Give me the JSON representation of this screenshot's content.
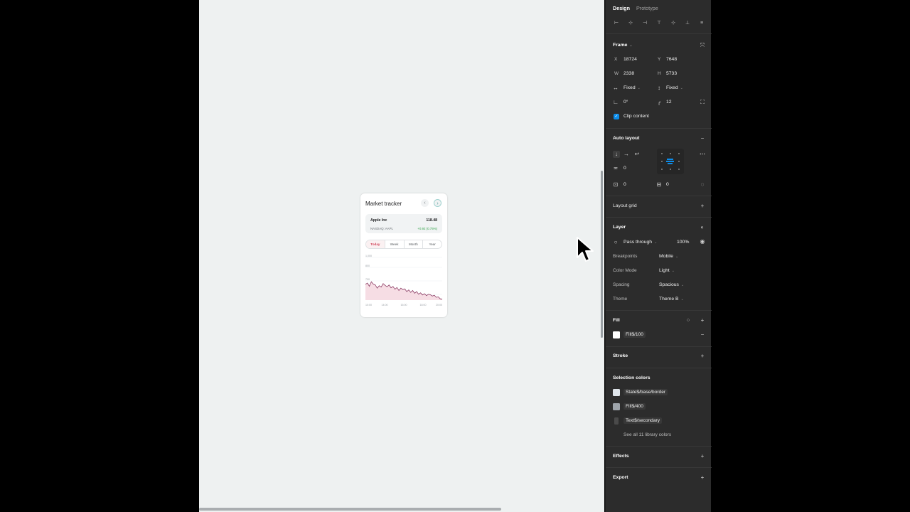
{
  "panel": {
    "tabs": [
      {
        "label": "Design",
        "active": true
      },
      {
        "label": "Prototype",
        "active": false
      }
    ],
    "frame": {
      "title": "Frame",
      "x_label": "X",
      "x": "18724",
      "y_label": "Y",
      "y": "7648",
      "w_label": "W",
      "w": "2338",
      "h_label": "H",
      "h": "5733",
      "width_mode": "Fixed",
      "height_mode": "Fixed",
      "rotation": "0°",
      "radius": "12",
      "clip_label": "Clip content"
    },
    "auto_layout": {
      "title": "Auto layout",
      "gap": "0",
      "padding_h": "0",
      "padding_v": "0"
    },
    "layout_grid": {
      "title": "Layout grid"
    },
    "layer": {
      "title": "Layer",
      "blend": "Pass through",
      "opacity": "100%",
      "props": [
        {
          "label": "Breakpoints",
          "value": "Mobile"
        },
        {
          "label": "Color Mode",
          "value": "Light"
        },
        {
          "label": "Spacing",
          "value": "Spacious"
        },
        {
          "label": "Theme",
          "value": "Theme B"
        }
      ]
    },
    "fill": {
      "title": "Fill",
      "value": "Fill$/100",
      "color": "#ffffff"
    },
    "stroke": {
      "title": "Stroke"
    },
    "selection_colors": {
      "title": "Selection colors",
      "items": [
        {
          "label": "State$/base/border",
          "color": "#dfe5ea"
        },
        {
          "label": "Fill$/400",
          "color": "#9ea4aa"
        },
        {
          "label": "Text$/secondary",
          "color": "#4a4a4a"
        }
      ],
      "see_all": "See all 11 library colors"
    },
    "effects": {
      "title": "Effects"
    },
    "export": {
      "title": "Export"
    }
  },
  "card": {
    "title": "Market tracker",
    "stock": {
      "name": "Apple Inc",
      "price": "118.48",
      "ticker": "NASDAQ: AAPL",
      "change": "+0.92 (0.75%)"
    },
    "tabs": [
      "Today",
      "Week",
      "Month",
      "Year"
    ],
    "active_tab": "Today",
    "accent_color": "#d0455a",
    "line_color": "#8b3a63"
  },
  "chart_data": {
    "type": "area",
    "title": "",
    "xlabel": "",
    "ylabel": "",
    "x": [
      "10:00",
      "14:00",
      "16:00",
      "18:00",
      "20:00"
    ],
    "y_ticks": [
      "1,000",
      "800",
      "700",
      "600"
    ],
    "ylim": [
      600,
      1000
    ],
    "series": [
      {
        "values": [
          748,
          760,
          730,
          772,
          750,
          742,
          712,
          735,
          722,
          755,
          738,
          725,
          742,
          715,
          728,
          702,
          718,
          690,
          712,
          698,
          705,
          680,
          695,
          672,
          690,
          664,
          680,
          655,
          668,
          648,
          660,
          642,
          655,
          650,
          638,
          645,
          626,
          630,
          612,
          608
        ]
      }
    ]
  }
}
